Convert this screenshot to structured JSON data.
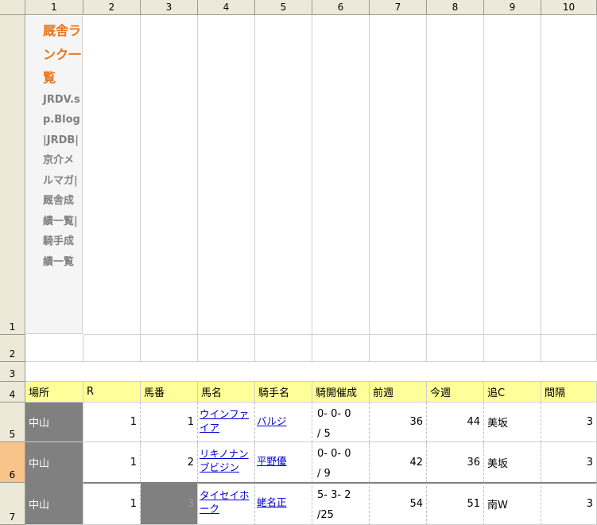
{
  "columns": [
    "1",
    "2",
    "3",
    "4",
    "5",
    "6",
    "7",
    "8",
    "9",
    "10"
  ],
  "rows": [
    "1",
    "2",
    "3",
    "4",
    "5",
    "6",
    "7"
  ],
  "title": {
    "main": "厩舎ランク一覧",
    "sub": "JRDV.sp.Blog|JRDB|京介メルマガ|厩舎成績一覧|騎手成績一覧"
  },
  "table": {
    "headers": [
      "場所",
      "R",
      "馬番",
      "馬名",
      "騎手名",
      "騎開催成",
      "前週",
      "今週",
      "追C",
      "間隔"
    ],
    "rows": [
      {
        "place": "中山",
        "r": "1",
        "num": "1",
        "horse": "ウインファイア",
        "jockey": "バルジ",
        "record_top": "0- 0- 0",
        "record_bottom": "/ 5",
        "prev_week": "36",
        "this_week": "44",
        "train": "美坂",
        "interval": "3"
      },
      {
        "place": "中山",
        "r": "1",
        "num": "2",
        "horse": "リキノナンブビジン",
        "jockey": "平野優",
        "record_top": "0- 0- 0",
        "record_bottom": "/ 9",
        "prev_week": "42",
        "this_week": "36",
        "train": "美坂",
        "interval": "3"
      },
      {
        "place": "中山",
        "r": "1",
        "num": "3",
        "horse": "タイセイホーク",
        "jockey": "蛯名正",
        "record_top": "5- 3- 2",
        "record_bottom": "/25",
        "prev_week": "54",
        "this_week": "51",
        "train": "南W",
        "interval": "3"
      }
    ]
  },
  "colors": {
    "accent_title": "#e8741c",
    "header_fill": "#ffff99",
    "place_fill": "#808080",
    "selected_row": "#f8c489"
  }
}
